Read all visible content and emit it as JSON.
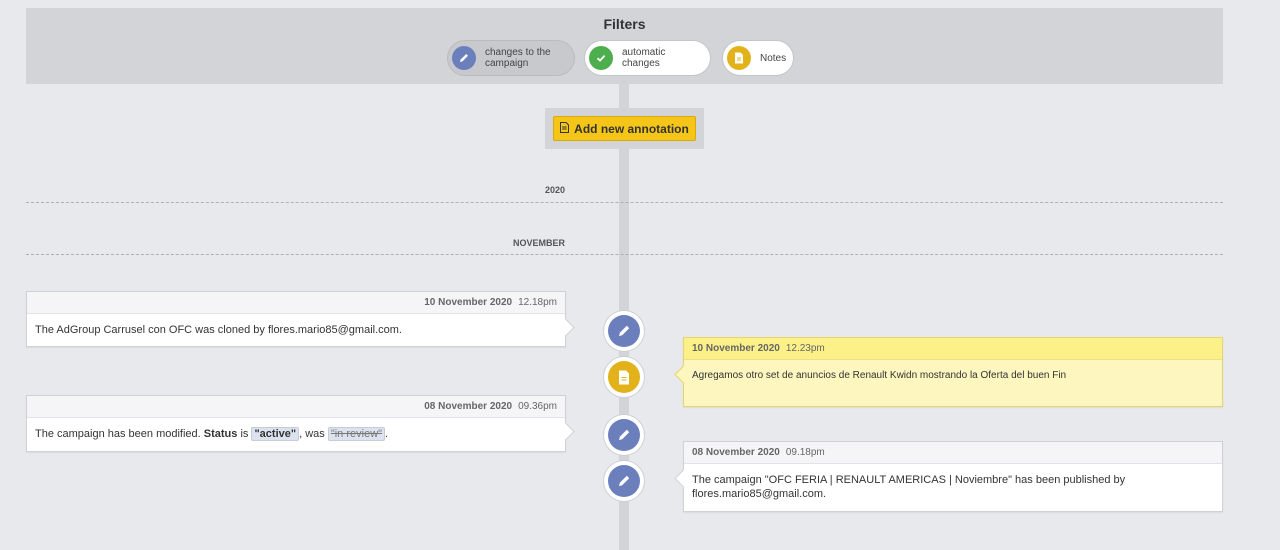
{
  "filters": {
    "title": "Filters",
    "items": [
      {
        "label": "changes to the\ncampaign",
        "icon": "pencil-icon",
        "color": "#6b7fbd",
        "active": true
      },
      {
        "label": "automatic\nchanges",
        "icon": "check-icon",
        "color": "#4cae4c",
        "active": false
      },
      {
        "label": "Notes",
        "icon": "document-icon",
        "color": "#e3b21b",
        "active": false
      }
    ]
  },
  "add_button": {
    "label": "Add new annotation",
    "icon": "document-icon",
    "color": "#f5c518"
  },
  "timeline": {
    "year": "2020",
    "month": "NOVEMBER",
    "entries": [
      {
        "side": "left",
        "type": "change",
        "date": "10 November 2020",
        "time": "12.18pm",
        "text": "The AdGroup Carrusel con OFC was cloned by flores.mario85@gmail.com."
      },
      {
        "side": "right",
        "type": "note",
        "date": "10 November 2020",
        "time": "12.23pm",
        "text": "Agregamos otro set de anuncios de Renault Kwidn mostrando la Oferta del buen Fin"
      },
      {
        "side": "left",
        "type": "change",
        "date": "08 November 2020",
        "time": "09.36pm",
        "text_prefix": "The campaign has been modified. ",
        "field": "Status",
        "is_word": " is ",
        "new_value": "\"active\"",
        "was_word": ", was ",
        "old_value": "\"in review\"",
        "text_suffix": "."
      },
      {
        "side": "right",
        "type": "change",
        "date": "08 November 2020",
        "time": "09.18pm",
        "text": "The campaign \"OFC FERIA | RENAULT AMERICAS | Noviembre\" has been published by flores.mario85@gmail.com."
      }
    ]
  },
  "colors": {
    "change": "#6b7fbd",
    "note": "#e3b21b",
    "automatic": "#4cae4c",
    "spine": "#d3d4d8"
  }
}
